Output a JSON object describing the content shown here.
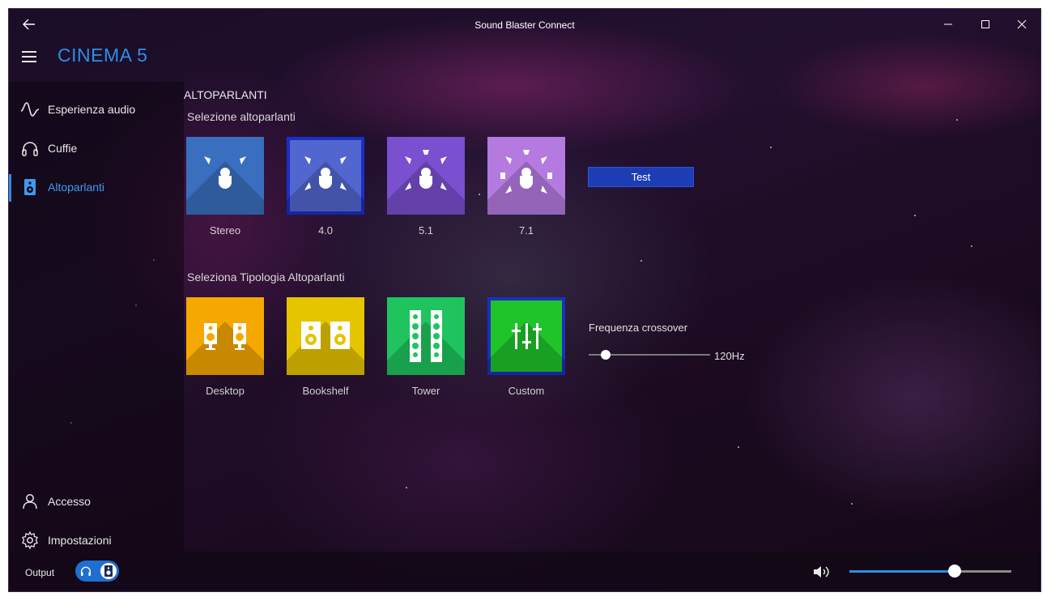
{
  "window": {
    "title": "Sound Blaster Connect",
    "device_name": "CINEMA 5"
  },
  "sidebar": {
    "items": [
      {
        "label": "Esperienza audio",
        "icon": "waveform-icon",
        "active": false
      },
      {
        "label": "Cuffie",
        "icon": "headphones-icon",
        "active": false
      },
      {
        "label": "Altoparlanti",
        "icon": "speaker-icon",
        "active": true
      }
    ],
    "bottom_items": [
      {
        "label": "Accesso",
        "icon": "person-icon"
      },
      {
        "label": "Impostazioni",
        "icon": "gear-icon"
      }
    ]
  },
  "main": {
    "section_title": "ALTOPARLANTI",
    "speaker_selection": {
      "title": "Selezione altoparlanti",
      "options": [
        {
          "label": "Stereo",
          "color": "#3a6fc0",
          "selected": false
        },
        {
          "label": "4.0",
          "color": "#5266d0",
          "selected": true
        },
        {
          "label": "5.1",
          "color": "#7a4fd0",
          "selected": false
        },
        {
          "label": "7.1",
          "color": "#b47ae0",
          "selected": false
        }
      ],
      "test_button": "Test"
    },
    "speaker_type": {
      "title": "Seleziona Tipologia Altoparlanti",
      "options": [
        {
          "label": "Desktop",
          "color": "#f5a800",
          "selected": false
        },
        {
          "label": "Bookshelf",
          "color": "#e5c400",
          "selected": false
        },
        {
          "label": "Tower",
          "color": "#1fc45e",
          "selected": false
        },
        {
          "label": "Custom",
          "color": "#1fc42a",
          "selected": true
        }
      ]
    },
    "crossover": {
      "label": "Frequenza crossover",
      "value": "120Hz"
    }
  },
  "bottombar": {
    "output_label": "Output",
    "output_toggle_icons": [
      "headphones-icon",
      "speaker-icon"
    ],
    "output_selected": "speaker",
    "volume_level": 0.65
  },
  "colors": {
    "accent": "#2d8ee8",
    "selection_border": "#1a2fc4",
    "test_button": "#1d3db4"
  }
}
